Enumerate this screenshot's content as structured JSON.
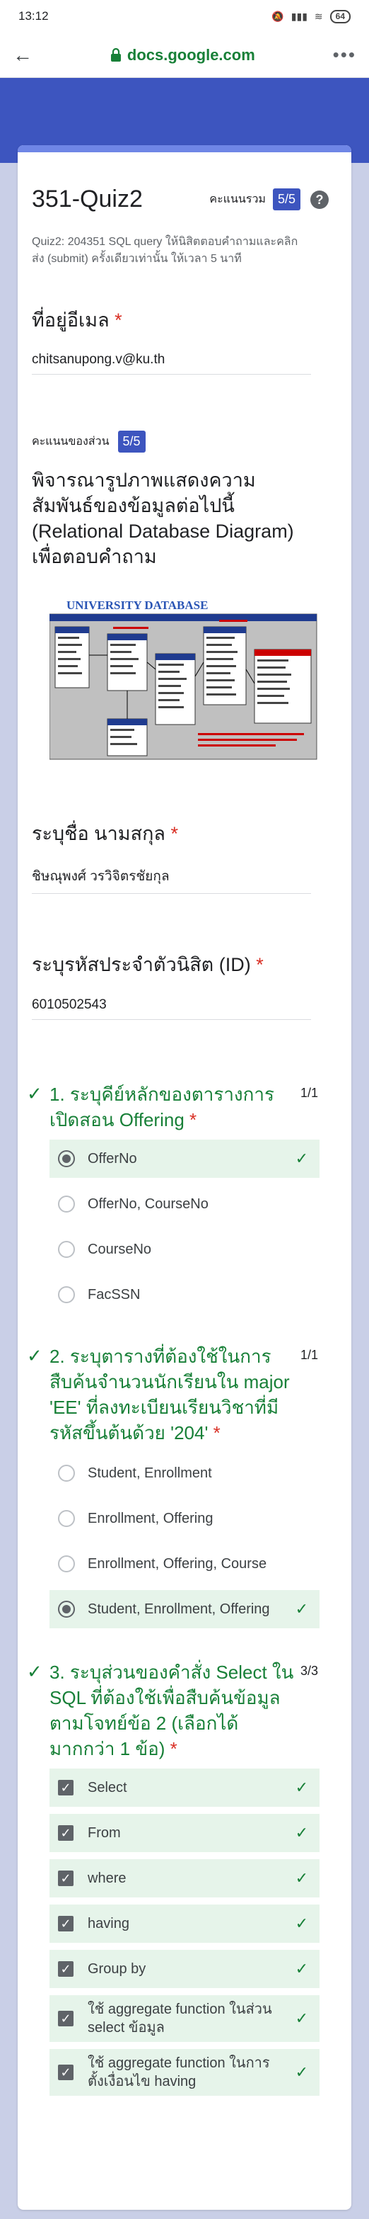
{
  "status": {
    "time": "13:12",
    "battery": "64"
  },
  "browser": {
    "url": "docs.google.com"
  },
  "form": {
    "title": "351-Quiz2",
    "total_label": "คะแนนรวม",
    "total_score": "5/5",
    "description": "Quiz2: 204351 SQL query  ให้นิสิตตอบคำถามและคลิกส่ง (submit) ครั้งเดียวเท่านั้น  ให้เวลา 5 นาที"
  },
  "email": {
    "label": "ที่อยู่อีเมล",
    "value": "chitsanupong.v@ku.th"
  },
  "section": {
    "score_label": "คะแนนของส่วน",
    "score": "5/5",
    "heading": "พิจารณารูปภาพแสดงความสัมพันธ์ของข้อมูลต่อไปนี้ (Relational Database Diagram) เพื่อตอบคำถาม",
    "diagram_title": "UNIVERSITY DATABASE"
  },
  "name": {
    "label": "ระบุชื่อ นามสกุล",
    "value": "ชิษณุพงศ์ วรวิจิตรชัยกุล"
  },
  "student_id": {
    "label": "ระบุรหัสประจำตัวนิสิต (ID)",
    "value": "6010502543"
  },
  "q1": {
    "text": "1. ระบุคีย์หลักของตารางการเปิดสอน Offering",
    "points": "1/1",
    "options": [
      "OfferNo",
      "OfferNo, CourseNo",
      "CourseNo",
      "FacSSN"
    ]
  },
  "q2": {
    "text": "2. ระบุตารางที่ต้องใช้ในการสืบค้นจำนวนนักเรียนใน major 'EE' ที่ลงทะเบียนเรียนวิชาที่มีรหัสขึ้นต้นด้วย '204'",
    "points": "1/1",
    "options": [
      "Student, Enrollment",
      "Enrollment, Offering",
      "Enrollment, Offering, Course",
      "Student, Enrollment, Offering"
    ]
  },
  "q3": {
    "text": "3. ระบุส่วนของคำสั่ง Select ใน SQL ที่ต้องใช้เพื่อสืบค้นข้อมูลตามโจทย์ข้อ 2 (เลือกได้มากกว่า 1 ข้อ)",
    "points": "3/3",
    "options": [
      "Select",
      "From",
      "where",
      "having",
      "Group by",
      "ใช้ aggregate function ในส่วน select ข้อมูล",
      "ใช้ aggregate function ในการตั้งเงื่อนไข having"
    ]
  },
  "colors": {
    "accent": "#3d55bf",
    "correct": "#188038",
    "background": "#c9cfe7"
  }
}
